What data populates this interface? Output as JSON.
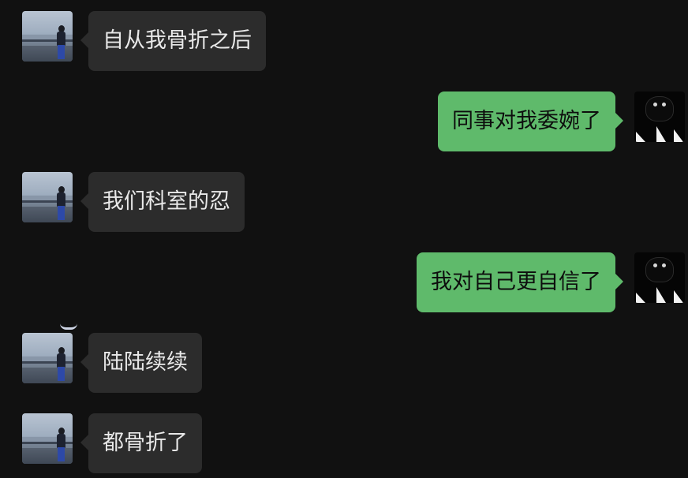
{
  "conversation": {
    "messages": [
      {
        "sender": "other",
        "avatar": "landscape-person-avatar",
        "text": "自从我骨折之后"
      },
      {
        "sender": "self",
        "avatar": "black-cat-avatar",
        "text": "同事对我委婉了"
      },
      {
        "sender": "other",
        "avatar": "landscape-person-avatar",
        "text": "我们科室的忍"
      },
      {
        "sender": "self",
        "avatar": "black-cat-avatar",
        "text": "我对自己更自信了"
      },
      {
        "sender": "other",
        "avatar": "landscape-person-avatar",
        "text": "陆陆续续"
      },
      {
        "sender": "other",
        "avatar": "landscape-person-avatar",
        "text": "都骨折了"
      }
    ]
  },
  "theme": {
    "background": "#111111",
    "incoming_bubble": "#2c2c2c",
    "incoming_text": "#e9e9e9",
    "outgoing_bubble": "#5fba6b",
    "outgoing_text": "#0d0d0d"
  }
}
